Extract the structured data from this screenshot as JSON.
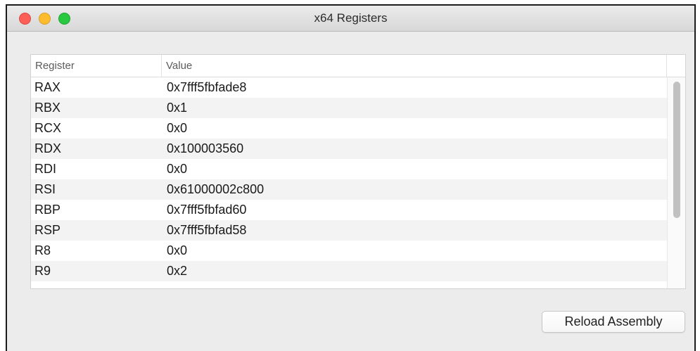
{
  "window": {
    "title": "x64 Registers"
  },
  "table": {
    "headers": {
      "register": "Register",
      "value": "Value"
    },
    "rows": [
      {
        "register": "RAX",
        "value": "0x7fff5fbfade8"
      },
      {
        "register": "RBX",
        "value": "0x1"
      },
      {
        "register": "RCX",
        "value": "0x0"
      },
      {
        "register": "RDX",
        "value": "0x100003560"
      },
      {
        "register": "RDI",
        "value": "0x0"
      },
      {
        "register": "RSI",
        "value": "0x61000002c800"
      },
      {
        "register": "RBP",
        "value": "0x7fff5fbfad60"
      },
      {
        "register": "RSP",
        "value": "0x7fff5fbfad58"
      },
      {
        "register": "R8",
        "value": "0x0"
      },
      {
        "register": "R9",
        "value": "0x2"
      }
    ]
  },
  "actions": {
    "reload_label": "Reload Assembly"
  },
  "icons": {
    "close": "close-icon",
    "minimize": "minimize-icon",
    "zoom": "zoom-icon"
  },
  "colors": {
    "close": "#fc5f57",
    "minimize": "#fdbc2e",
    "zoom": "#28c840"
  }
}
